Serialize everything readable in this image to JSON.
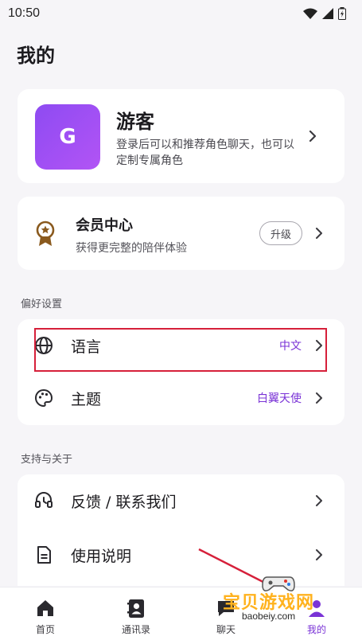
{
  "status_bar": {
    "time": "10:50"
  },
  "page_title": "我的",
  "profile": {
    "avatar_letter": "G",
    "name": "游客",
    "description": "登录后可以和推荐角色聊天，也可以定制专属角色"
  },
  "vip": {
    "title": "会员中心",
    "description": "获得更完整的陪伴体验",
    "upgrade_label": "升级"
  },
  "preferences": {
    "section_label": "偏好设置",
    "language": {
      "label": "语言",
      "value": "中文"
    },
    "theme": {
      "label": "主题",
      "value": "白翼天使"
    }
  },
  "support": {
    "section_label": "支持与关于",
    "feedback": {
      "label": "反馈 / 联系我们"
    },
    "manual": {
      "label": "使用说明"
    }
  },
  "bottom_nav": {
    "items": [
      {
        "label": "首页",
        "icon": "home-icon"
      },
      {
        "label": "通讯录",
        "icon": "contacts-icon"
      },
      {
        "label": "聊天",
        "icon": "chat-icon"
      },
      {
        "label": "我的",
        "icon": "profile-icon"
      }
    ],
    "active": "我的"
  },
  "watermark": {
    "title": "宝贝游戏网",
    "url": "baobeiy.com"
  },
  "colors": {
    "accent": "#7a33d6",
    "avatar_gradient_start": "#8e4bf2",
    "avatar_gradient_end": "#b254f5",
    "highlight_box": "#d6203a",
    "background": "#f6f5f8"
  }
}
